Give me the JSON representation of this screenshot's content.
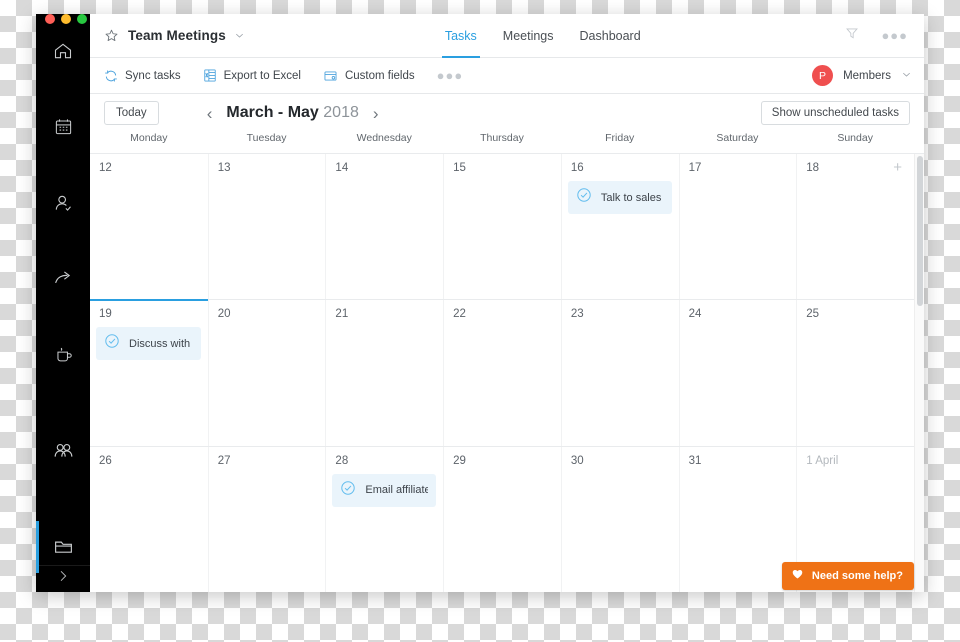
{
  "window": {
    "traffic_lights": [
      "close",
      "minimize",
      "zoom"
    ]
  },
  "sidebar": {
    "items": [
      {
        "name": "home",
        "icon": "home-icon"
      },
      {
        "name": "calendar",
        "icon": "calendar-icon"
      },
      {
        "name": "contact",
        "icon": "person-icon"
      },
      {
        "name": "share",
        "icon": "arrow-share-icon"
      },
      {
        "name": "breaks",
        "icon": "coffee-cup-icon"
      },
      {
        "name": "team",
        "icon": "people-group-icon"
      },
      {
        "name": "projects",
        "icon": "folder-icon",
        "active": true
      }
    ],
    "expand": "expand-chevron-icon"
  },
  "header": {
    "star_icon": "star-icon",
    "project_title": "Team Meetings",
    "caret_icon": "chevron-down-icon",
    "tabs": [
      {
        "label": "Tasks",
        "active": true
      },
      {
        "label": "Meetings",
        "active": false
      },
      {
        "label": "Dashboard",
        "active": false
      }
    ],
    "filter_icon": "filter-funnel-icon",
    "more_icon": "more-dots-icon",
    "more_glyph": "●●●"
  },
  "toolbar": {
    "sync_label": "Sync tasks",
    "sync_icon": "sync-refresh-icon",
    "export_label": "Export to Excel",
    "export_icon": "excel-file-icon",
    "custom_fields_label": "Custom fields",
    "custom_fields_icon": "custom-fields-icon",
    "more_icon": "more-dots-icon",
    "more_glyph": "●●●",
    "avatar_initial": "P",
    "members_label": "Members",
    "members_caret": "chevron-down-icon"
  },
  "datebar": {
    "today_label": "Today",
    "prev_icon": "chevron-left-icon",
    "prev_glyph": "‹",
    "next_icon": "chevron-right-icon",
    "next_glyph": "›",
    "range_bold": "March - May",
    "range_year": "2018",
    "unscheduled_label": "Show unscheduled tasks"
  },
  "calendar": {
    "weekdays": [
      "Monday",
      "Tuesday",
      "Wednesday",
      "Thursday",
      "Friday",
      "Saturday",
      "Sunday"
    ],
    "add_glyph": "+",
    "weeks": [
      {
        "today_marker": false,
        "days": [
          {
            "num": "12",
            "muted": false,
            "task": null,
            "plus": false
          },
          {
            "num": "13",
            "muted": false,
            "task": null,
            "plus": false
          },
          {
            "num": "14",
            "muted": false,
            "task": null,
            "plus": false
          },
          {
            "num": "15",
            "muted": false,
            "task": null,
            "plus": false
          },
          {
            "num": "16",
            "muted": false,
            "task": "Talk to sales …",
            "plus": false
          },
          {
            "num": "17",
            "muted": false,
            "task": null,
            "plus": false
          },
          {
            "num": "18",
            "muted": false,
            "task": null,
            "plus": true
          }
        ]
      },
      {
        "today_marker": true,
        "days": [
          {
            "num": "19",
            "muted": false,
            "task": "Discuss with …",
            "plus": false
          },
          {
            "num": "20",
            "muted": false,
            "task": null,
            "plus": false
          },
          {
            "num": "21",
            "muted": false,
            "task": null,
            "plus": false
          },
          {
            "num": "22",
            "muted": false,
            "task": null,
            "plus": false
          },
          {
            "num": "23",
            "muted": false,
            "task": null,
            "plus": false
          },
          {
            "num": "24",
            "muted": false,
            "task": null,
            "plus": false
          },
          {
            "num": "25",
            "muted": false,
            "task": null,
            "plus": false
          }
        ]
      },
      {
        "today_marker": false,
        "days": [
          {
            "num": "26",
            "muted": false,
            "task": null,
            "plus": false
          },
          {
            "num": "27",
            "muted": false,
            "task": null,
            "plus": false
          },
          {
            "num": "28",
            "muted": false,
            "task": "Email affiliate…",
            "plus": false
          },
          {
            "num": "29",
            "muted": false,
            "task": null,
            "plus": false
          },
          {
            "num": "30",
            "muted": false,
            "task": null,
            "plus": false
          },
          {
            "num": "31",
            "muted": false,
            "task": null,
            "plus": false
          },
          {
            "num": "1 April",
            "muted": true,
            "task": null,
            "plus": false
          }
        ]
      }
    ]
  },
  "help": {
    "label": "Need some help?",
    "icon": "heart-icon"
  },
  "colors": {
    "accent": "#2a9fe0",
    "task_card": "#eaf4fb",
    "avatar": "#ef4f4f",
    "help_orange": "#ef7216",
    "sidebar": "#000000"
  }
}
